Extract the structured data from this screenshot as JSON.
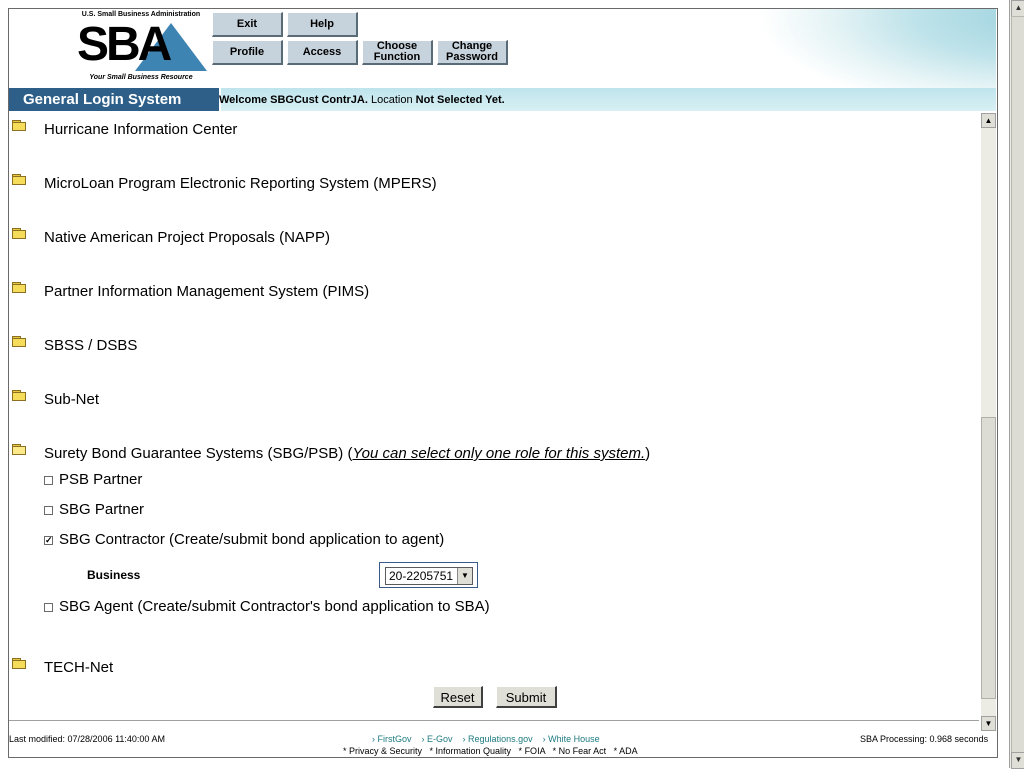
{
  "logo": {
    "agency": "U.S. Small Business Administration",
    "mark": "SBA",
    "tagline": "Your Small Business Resource"
  },
  "nav": {
    "exit": "Exit",
    "help": "Help",
    "profile": "Profile",
    "access": "Access",
    "choose_line1": "Choose",
    "choose_line2": "Function",
    "change_line1": "Change",
    "change_line2": "Password"
  },
  "titlebar": {
    "app_name": "General Login System",
    "welcome_prefix": "Welcome SBGCust ContrJA.",
    "location_label": "Location",
    "location_value": "Not Selected Yet."
  },
  "systems": [
    "Hurricane Information Center",
    "MicroLoan Program Electronic Reporting System (MPERS)",
    "Native American Project Proposals (NAPP)",
    "Partner Information Management System (PIMS)",
    "SBSS / DSBS",
    "Sub-Net"
  ],
  "surety": {
    "name": "Surety Bond Guarantee Systems (SBG/PSB) (",
    "note": "You can select only one role for this system.",
    "close": ")",
    "roles": [
      {
        "label": "PSB Partner",
        "checked": false
      },
      {
        "label": "SBG Partner",
        "checked": false
      },
      {
        "label": "SBG Contractor (Create/submit bond application to agent)",
        "checked": true
      },
      {
        "label": "SBG Agent (Create/submit Contractor's bond application to SBA)",
        "checked": false
      }
    ],
    "business_label": "Business",
    "business_value": "20-2205751"
  },
  "tech_net": "TECH-Net",
  "form": {
    "reset": "Reset",
    "submit": "Submit"
  },
  "footer": {
    "last_modified": "Last modified: 07/28/2006 11:40:00 AM",
    "links": [
      "› FirstGov",
      "› E-Gov",
      "› Regulations.gov",
      "› White House"
    ],
    "policies": "* Privacy & Security   * Information Quality   * FOIA   * No Fear Act   * ADA",
    "processing": "SBA Processing:  0.968 seconds"
  }
}
